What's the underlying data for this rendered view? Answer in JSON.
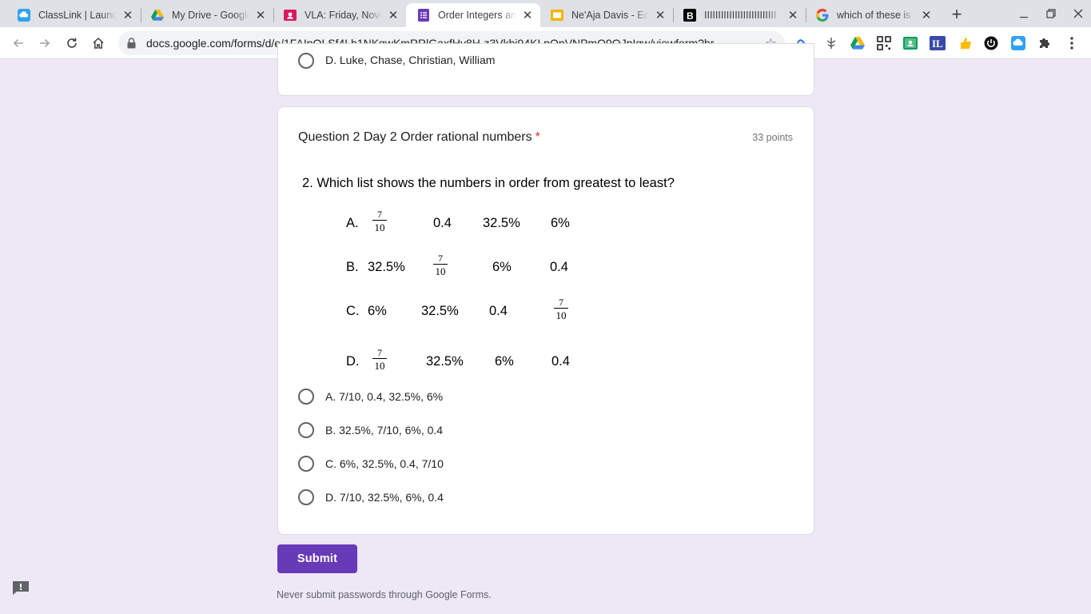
{
  "browser": {
    "tabs": [
      {
        "title": "ClassLink | Launchpad",
        "icon": "classlink-icon",
        "active": false
      },
      {
        "title": "My Drive - Google Drive",
        "icon": "google-drive-icon",
        "active": false
      },
      {
        "title": "VLA: Friday, November",
        "icon": "classroom-icon",
        "active": false
      },
      {
        "title": "Order Integers and",
        "icon": "google-forms-icon",
        "active": true
      },
      {
        "title": "Ne'Aja Davis - Echo",
        "icon": "google-slides-icon",
        "active": false
      },
      {
        "title": "IIIIIIIIIIIIIIIIIIIIIIIIII",
        "icon": "brainly-icon",
        "active": false
      },
      {
        "title": "which of these is",
        "icon": "google-icon",
        "active": false
      }
    ],
    "url": "docs.google.com/forms/d/e/1FAIpQLSf4Lh1NKgwKmRRlGaxfHy8H-z3Vkhj94KLpOpVNPmQ9QJpIgw/viewform?hr...",
    "colors": {
      "accent": "#673ab7",
      "required": "#d93025",
      "page_bg": "#ede7f6"
    }
  },
  "form": {
    "previous_question_choice": "D. Luke, Chase, Christian, William",
    "question": {
      "title": "Question 2 Day 2 Order rational numbers",
      "required_mark": "*",
      "points": "33 points",
      "image": {
        "prompt": "2. Which list shows the numbers in order from greatest to least?",
        "rows": [
          {
            "letter": "A.",
            "items": [
              "7/10",
              "0.4",
              "32.5%",
              "6%"
            ]
          },
          {
            "letter": "B.",
            "items": [
              "32.5%",
              "7/10",
              "6%",
              "0.4"
            ]
          },
          {
            "letter": "C.",
            "items": [
              "6%",
              "32.5%",
              "0.4",
              "7/10"
            ]
          },
          {
            "letter": "D.",
            "items": [
              "7/10",
              "32.5%",
              "6%",
              "0.4"
            ]
          }
        ],
        "fraction": {
          "numerator": "7",
          "denominator": "10"
        }
      },
      "choices": [
        "A. 7/10, 0.4, 32.5%, 6%",
        "B. 32.5%, 7/10, 6%, 0.4",
        "C. 6%, 32.5%, 0.4, 7/10",
        "D. 7/10, 32.5%, 6%, 0.4"
      ]
    },
    "submit_label": "Submit",
    "footer_note": "Never submit passwords through Google Forms."
  }
}
